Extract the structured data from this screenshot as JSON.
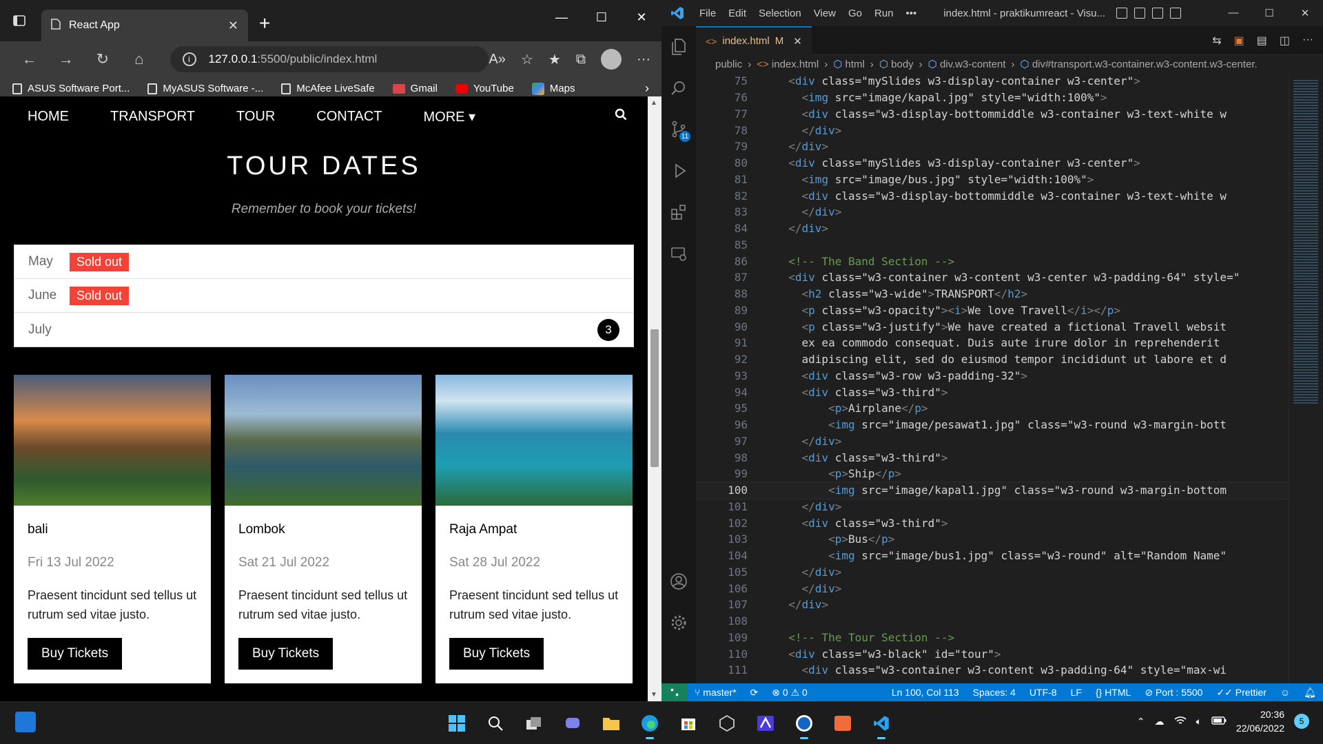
{
  "browser": {
    "tab_title": "React App",
    "url_host": "127.0.0.1",
    "url_path": ":5500/public/index.html",
    "favorites": [
      {
        "label": "ASUS Software Port...",
        "icon": "page-icon"
      },
      {
        "label": "MyASUS Software -...",
        "icon": "page-icon"
      },
      {
        "label": "McAfee LiveSafe",
        "icon": "page-icon"
      },
      {
        "label": "Gmail",
        "icon": "gmail-icon"
      },
      {
        "label": "YouTube",
        "icon": "youtube-icon"
      },
      {
        "label": "Maps",
        "icon": "maps-icon"
      }
    ]
  },
  "site": {
    "nav": [
      "HOME",
      "TRANSPORT",
      "TOUR",
      "CONTACT",
      "MORE"
    ],
    "tour_title": "TOUR DATES",
    "tour_subtitle": "Remember to book your tickets!",
    "months": [
      {
        "name": "May",
        "badge": "Sold out"
      },
      {
        "name": "June",
        "badge": "Sold out"
      },
      {
        "name": "July",
        "count": "3"
      }
    ],
    "cards": [
      {
        "name": "bali",
        "date": "Fri 13 Jul 2022",
        "desc": "Praesent tincidunt sed tellus ut rutrum sed vitae justo.",
        "button": "Buy Tickets"
      },
      {
        "name": "Lombok",
        "date": "Sat 21 Jul 2022",
        "desc": "Praesent tincidunt sed tellus ut rutrum sed vitae justo.",
        "button": "Buy Tickets"
      },
      {
        "name": "Raja Ampat",
        "date": "Sat 28 Jul 2022",
        "desc": "Praesent tincidunt sed tellus ut rutrum sed vitae justo.",
        "button": "Buy Tickets"
      }
    ]
  },
  "vscode": {
    "menu": [
      "File",
      "Edit",
      "Selection",
      "View",
      "Go",
      "Run",
      "•••"
    ],
    "window_title": "index.html - praktikumreact - Visu...",
    "tab": {
      "label": "index.html",
      "flag": "M"
    },
    "source_control_count": "11",
    "breadcrumbs": [
      "public",
      "index.html",
      "html",
      "body",
      "div.w3-content",
      "div#transport.w3-container.w3-content.w3-center."
    ],
    "lines": [
      {
        "n": "75",
        "t": "  <div class=\"mySlides w3-display-container w3-center\">"
      },
      {
        "n": "76",
        "t": "    <img src=\"image/kapal.jpg\" style=\"width:100%\">"
      },
      {
        "n": "77",
        "t": "    <div class=\"w3-display-bottommiddle w3-container w3-text-white w"
      },
      {
        "n": "78",
        "t": "    </div>"
      },
      {
        "n": "79",
        "t": "  </div>"
      },
      {
        "n": "80",
        "t": "  <div class=\"mySlides w3-display-container w3-center\">"
      },
      {
        "n": "81",
        "t": "    <img src=\"image/bus.jpg\" style=\"width:100%\">"
      },
      {
        "n": "82",
        "t": "    <div class=\"w3-display-bottommiddle w3-container w3-text-white w"
      },
      {
        "n": "83",
        "t": "    </div>"
      },
      {
        "n": "84",
        "t": "  </div>"
      },
      {
        "n": "85",
        "t": ""
      },
      {
        "n": "86",
        "t": "  <!-- The Band Section -->"
      },
      {
        "n": "87",
        "t": "  <div class=\"w3-container w3-content w3-center w3-padding-64\" style=\""
      },
      {
        "n": "88",
        "t": "    <h2 class=\"w3-wide\">TRANSPORT</h2>"
      },
      {
        "n": "89",
        "t": "    <p class=\"w3-opacity\"><i>We love Travell</i></p>"
      },
      {
        "n": "90",
        "t": "    <p class=\"w3-justify\">We have created a fictional Travell websit"
      },
      {
        "n": "91",
        "t": "    ex ea commodo consequat. Duis aute irure dolor in reprehenderit"
      },
      {
        "n": "92",
        "t": "    adipiscing elit, sed do eiusmod tempor incididunt ut labore et d"
      },
      {
        "n": "93",
        "t": "    <div class=\"w3-row w3-padding-32\">"
      },
      {
        "n": "94",
        "t": "    <div class=\"w3-third\">"
      },
      {
        "n": "95",
        "t": "        <p>Airplane</p>"
      },
      {
        "n": "96",
        "t": "        <img src=\"image/pesawat1.jpg\" class=\"w3-round w3-margin-bott"
      },
      {
        "n": "97",
        "t": "    </div>"
      },
      {
        "n": "98",
        "t": "    <div class=\"w3-third\">"
      },
      {
        "n": "99",
        "t": "        <p>Ship</p>"
      },
      {
        "n": "100",
        "t": "        <img src=\"image/kapal1.jpg\" class=\"w3-round w3-margin-bottom"
      },
      {
        "n": "101",
        "t": "    </div>"
      },
      {
        "n": "102",
        "t": "    <div class=\"w3-third\">"
      },
      {
        "n": "103",
        "t": "        <p>Bus</p>"
      },
      {
        "n": "104",
        "t": "        <img src=\"image/bus1.jpg\" class=\"w3-round\" alt=\"Random Name\""
      },
      {
        "n": "105",
        "t": "    </div>"
      },
      {
        "n": "106",
        "t": "    </div>"
      },
      {
        "n": "107",
        "t": "  </div>"
      },
      {
        "n": "108",
        "t": ""
      },
      {
        "n": "109",
        "t": "  <!-- The Tour Section -->"
      },
      {
        "n": "110",
        "t": "  <div class=\"w3-black\" id=\"tour\">"
      },
      {
        "n": "111",
        "t": "    <div class=\"w3-container w3-content w3-padding-64\" style=\"max-wi"
      }
    ],
    "current_line": "100",
    "status": {
      "branch": "master*",
      "errors": "0",
      "warnings": "0",
      "position": "Ln 100, Col 113",
      "spaces": "Spaces: 4",
      "encoding": "UTF-8",
      "eol": "LF",
      "language": "HTML",
      "port": "Port : 5500",
      "prettier": "Prettier"
    }
  },
  "taskbar": {
    "time": "20:36",
    "date": "22/06/2022",
    "notifications": "5"
  },
  "colors": {
    "sold_out": "#f44336",
    "vscode_status": "#0078d4",
    "vscode_remote": "#16825d"
  }
}
